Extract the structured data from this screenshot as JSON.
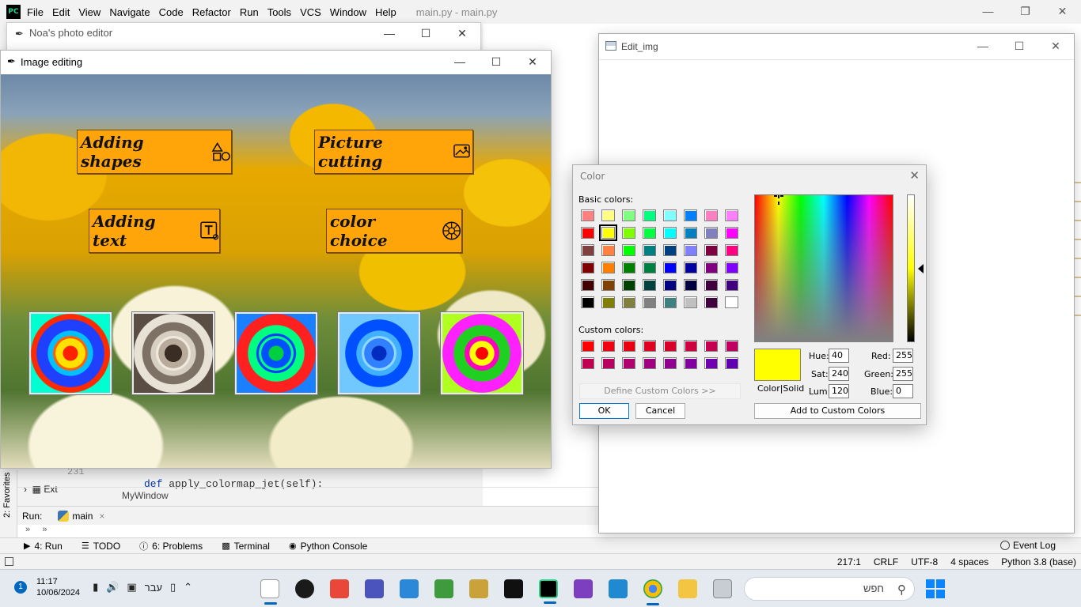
{
  "ide": {
    "menu": [
      "File",
      "Edit",
      "View",
      "Navigate",
      "Code",
      "Refactor",
      "Run",
      "Tools",
      "VCS",
      "Window",
      "Help"
    ],
    "title": "main.py - main.py",
    "code_line_keyword": "def",
    "code_line_rest": " apply_colormap_jet(self):",
    "line_number": "231",
    "project_item": "Ext",
    "breadcrumb": "MyWindow",
    "favorites_label": "2: Favorites",
    "run_label": "Run:",
    "run_tab": "main",
    "tool_tabs": [
      "4: Run",
      "TODO",
      "6: Problems",
      "Terminal",
      "Python Console"
    ],
    "event_log": "Event Log",
    "status": [
      "217:1",
      "CRLF",
      "UTF-8",
      "4 spaces",
      "Python 3.8 (base)"
    ]
  },
  "noa_window": {
    "title": "Noa's photo editor"
  },
  "image_window": {
    "title": "Image editing",
    "buttons": {
      "shapes": "Adding shapes",
      "cutting": "Picture cutting",
      "text": "Adding text",
      "color": "color choice"
    }
  },
  "edit_window": {
    "title": "Edit_img"
  },
  "color_dialog": {
    "title": "Color",
    "basic_label": "Basic colors:",
    "custom_label": "Custom colors:",
    "define_btn": "Define Custom Colors >>",
    "ok_btn": "OK",
    "cancel_btn": "Cancel",
    "add_btn": "Add to Custom Colors",
    "color_solid": "Color|Solid",
    "hue_label": "Hue:",
    "hue": "40",
    "sat_label": "Sat:",
    "sat": "240",
    "lum_label": "Lum:",
    "lum": "120",
    "red_label": "Red:",
    "red": "255",
    "green_label": "Green:",
    "green": "255",
    "blue_label": "Blue:",
    "blue": "0",
    "basic_colors": [
      [
        "#ff8080",
        "#ffff80",
        "#80ff80",
        "#00ff80",
        "#80ffff",
        "#0080ff",
        "#ff80c0",
        "#ff80ff"
      ],
      [
        "#ff0000",
        "#ffff00",
        "#80ff00",
        "#00ff40",
        "#00ffff",
        "#0080c0",
        "#8080c0",
        "#ff00ff"
      ],
      [
        "#804040",
        "#ff8040",
        "#00ff00",
        "#008080",
        "#004080",
        "#8080ff",
        "#800040",
        "#ff0080"
      ],
      [
        "#800000",
        "#ff8000",
        "#008000",
        "#008040",
        "#0000ff",
        "#0000a0",
        "#800080",
        "#8000ff"
      ],
      [
        "#400000",
        "#804000",
        "#004000",
        "#004040",
        "#000080",
        "#000040",
        "#400040",
        "#400080"
      ],
      [
        "#000000",
        "#808000",
        "#808040",
        "#808080",
        "#408080",
        "#c0c0c0",
        "#400040",
        "#ffffff"
      ]
    ],
    "custom_colors": [
      [
        "#ff0000",
        "#f00010",
        "#e80010",
        "#e00020",
        "#d80028",
        "#d00040",
        "#c80050",
        "#c00060"
      ],
      [
        "#c00050",
        "#b80060",
        "#b00070",
        "#a00080",
        "#900090",
        "#8000a0",
        "#7000b0",
        "#6000b0"
      ]
    ]
  },
  "taskbar": {
    "time": "11:17",
    "date": "10/06/2024",
    "lang": "עבר",
    "search": "חפש"
  }
}
